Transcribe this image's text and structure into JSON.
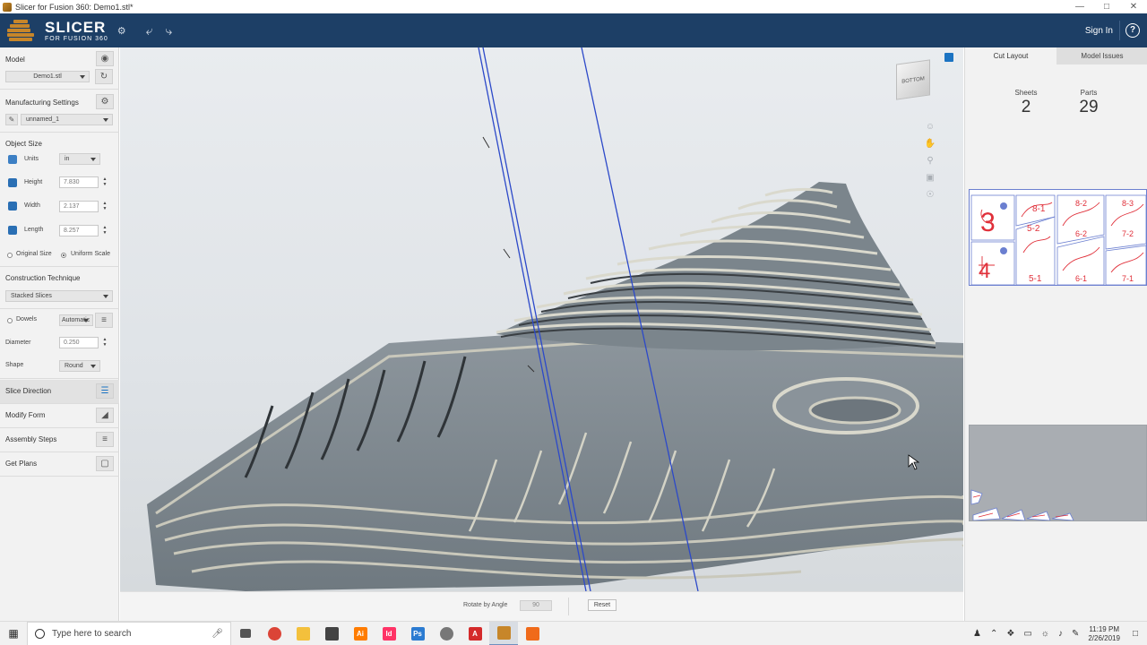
{
  "window": {
    "title": "Slicer for Fusion 360: Demo1.stl*"
  },
  "header": {
    "logo_big": "SLICER",
    "logo_small": "FOR FUSION 360",
    "sign_in": "Sign In",
    "help": "?"
  },
  "left": {
    "model_label": "Model",
    "model_file": "Demo1.stl",
    "mfg_label": "Manufacturing Settings",
    "mfg_value": "unnamed_1",
    "object_size_label": "Object Size",
    "units_label": "Units",
    "units_value": "in",
    "height_label": "Height",
    "height_value": "7.830",
    "width_label": "Width",
    "width_value": "2.137",
    "length_label": "Length",
    "length_value": "8.257",
    "original_size": "Original Size",
    "uniform_scale": "Uniform Scale",
    "construction_label": "Construction Technique",
    "construction_value": "Stacked Slices",
    "dowels_label": "Dowels",
    "dowels_value": "Automatic",
    "diameter_label": "Diameter",
    "diameter_value": "0.250",
    "shape_label": "Shape",
    "shape_value": "Round",
    "slice_direction": "Slice Direction",
    "modify_form": "Modify Form",
    "assembly_steps": "Assembly Steps",
    "get_plans": "Get Plans"
  },
  "viewport": {
    "viewcube_label": "BOTTOM"
  },
  "bottom": {
    "rotate_label": "Rotate by  Angle",
    "rotate_value": "90",
    "reset": "Reset"
  },
  "right": {
    "tab_cut_layout": "Cut Layout",
    "tab_model_issues": "Model Issues",
    "sheets_label": "Sheets",
    "sheets_value": "2",
    "parts_label": "Parts",
    "parts_value": "29",
    "sheet_labels": [
      "3",
      "8-1",
      "8-2",
      "8-3",
      "5-2",
      "6-2",
      "7-2",
      "4",
      "5-1",
      "6-1",
      "7-1"
    ]
  },
  "taskbar": {
    "search_placeholder": "Type here to search",
    "time": "11:19 PM",
    "date": "2/26/2019"
  },
  "colors": {
    "header": "#1d3f66",
    "accent": "#1b73c2",
    "logo": "#c7862a",
    "part_outline": "#e0303a"
  }
}
